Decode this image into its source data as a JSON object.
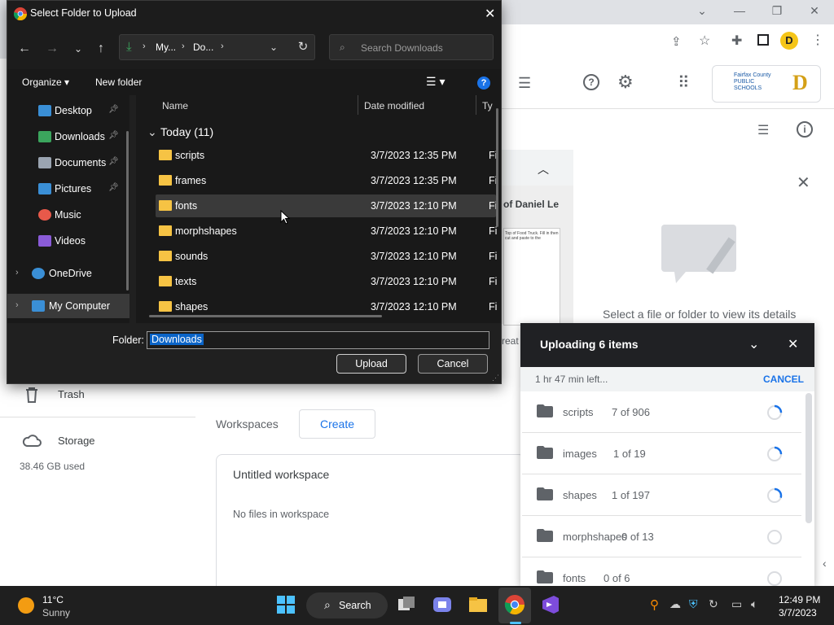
{
  "dialog": {
    "title": "Select Folder to Upload",
    "breadcrumb": [
      "My...",
      "Do..."
    ],
    "search_placeholder": "Search Downloads",
    "organize_label": "Organize",
    "new_folder_label": "New folder",
    "nav_items": [
      {
        "label": "Desktop",
        "icon": "desktop-icon",
        "pinned": true
      },
      {
        "label": "Downloads",
        "icon": "download-icon",
        "pinned": true
      },
      {
        "label": "Documents",
        "icon": "documents-icon",
        "pinned": true
      },
      {
        "label": "Pictures",
        "icon": "pictures-icon",
        "pinned": true
      },
      {
        "label": "Music",
        "icon": "music-icon",
        "pinned": false
      },
      {
        "label": "Videos",
        "icon": "videos-icon",
        "pinned": false
      },
      {
        "label": "OneDrive",
        "icon": "cloud-icon",
        "pinned": false
      },
      {
        "label": "My Computer",
        "icon": "computer-icon",
        "pinned": false
      }
    ],
    "columns": {
      "name": "Name",
      "date": "Date modified",
      "type": "Ty"
    },
    "group_label": "Today (11)",
    "files": [
      {
        "name": "scripts",
        "date": "3/7/2023 12:35 PM",
        "type": "Fi"
      },
      {
        "name": "frames",
        "date": "3/7/2023 12:35 PM",
        "type": "Fi"
      },
      {
        "name": "fonts",
        "date": "3/7/2023 12:10 PM",
        "type": "Fi"
      },
      {
        "name": "morphshapes",
        "date": "3/7/2023 12:10 PM",
        "type": "Fi"
      },
      {
        "name": "sounds",
        "date": "3/7/2023 12:10 PM",
        "type": "Fi"
      },
      {
        "name": "texts",
        "date": "3/7/2023 12:10 PM",
        "type": "Fi"
      },
      {
        "name": "shapes",
        "date": "3/7/2023 12:10 PM",
        "type": "Fi"
      }
    ],
    "folder_label": "Folder:",
    "folder_value": "Downloads",
    "upload_label": "Upload",
    "cancel_label": "Cancel"
  },
  "drive": {
    "trash_label": "Trash",
    "storage_label": "Storage",
    "storage_used": "38.46 GB used",
    "workspaces_label": "Workspaces",
    "create_label": "Create",
    "workspace_title": "Untitled workspace",
    "workspace_empty": "No files in workspace",
    "details_hint": "Select a file or folder to view its details",
    "preview_title": "of Daniel Le",
    "preview_text_line": "Top of Food Truck. Fill in then cut and paste to the",
    "preview_partial": "reat",
    "school_name": "Fairfax County PUBLIC SCHOOLS"
  },
  "upload_panel": {
    "title": "Uploading 6 items",
    "time_left": "1 hr 47 min left...",
    "cancel_label": "CANCEL",
    "items": [
      {
        "name": "scripts",
        "count": "7 of 906",
        "progress": 0.01
      },
      {
        "name": "images",
        "count": "1 of 19",
        "progress": 0.05
      },
      {
        "name": "shapes",
        "count": "1 of 197",
        "progress": 0.3
      },
      {
        "name": "morphshapes",
        "count": "0 of 13",
        "progress": 0
      },
      {
        "name": "fonts",
        "count": "0 of 6",
        "progress": 0
      }
    ]
  },
  "taskbar": {
    "weather_temp": "11°C",
    "weather_desc": "Sunny",
    "search_label": "Search",
    "time": "12:49 PM",
    "date": "3/7/2023"
  },
  "colors": {
    "accent": "#1a73e8",
    "folder": "#f6c344",
    "dialog_bg": "#202020"
  }
}
